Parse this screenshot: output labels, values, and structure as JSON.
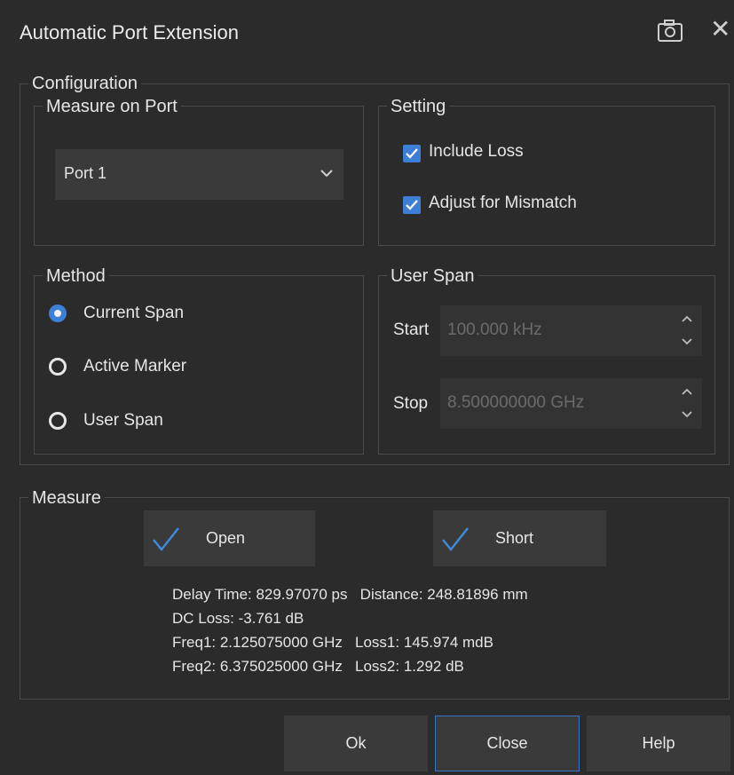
{
  "window": {
    "title": "Automatic Port Extension"
  },
  "configuration": {
    "legend": "Configuration",
    "measure_on_port": {
      "legend": "Measure on Port",
      "selected": "Port 1"
    },
    "setting": {
      "legend": "Setting",
      "include_loss": {
        "label": "Include Loss",
        "checked": true
      },
      "adjust_mismatch": {
        "label": "Adjust for Mismatch",
        "checked": true
      }
    },
    "method": {
      "legend": "Method",
      "options": [
        {
          "label": "Current Span",
          "selected": true
        },
        {
          "label": "Active Marker",
          "selected": false
        },
        {
          "label": "User Span",
          "selected": false
        }
      ]
    },
    "user_span": {
      "legend": "User Span",
      "start": {
        "label": "Start",
        "value": "100.000 kHz"
      },
      "stop": {
        "label": "Stop",
        "value": "8.500000000 GHz"
      }
    }
  },
  "measure": {
    "legend": "Measure",
    "open_label": "Open",
    "short_label": "Short",
    "results": {
      "line1": "Delay Time: 829.97070 ps   Distance: 248.81896 mm",
      "line2": "DC Loss: -3.761 dB",
      "line3": "Freq1: 2.125075000 GHz   Loss1: 145.974 mdB",
      "line4": "Freq2: 6.375025000 GHz   Loss2: 1.292 dB"
    }
  },
  "footer": {
    "ok": "Ok",
    "close": "Close",
    "help": "Help"
  },
  "colors": {
    "accent": "#3d7fd6",
    "background": "#2b2b2b"
  }
}
